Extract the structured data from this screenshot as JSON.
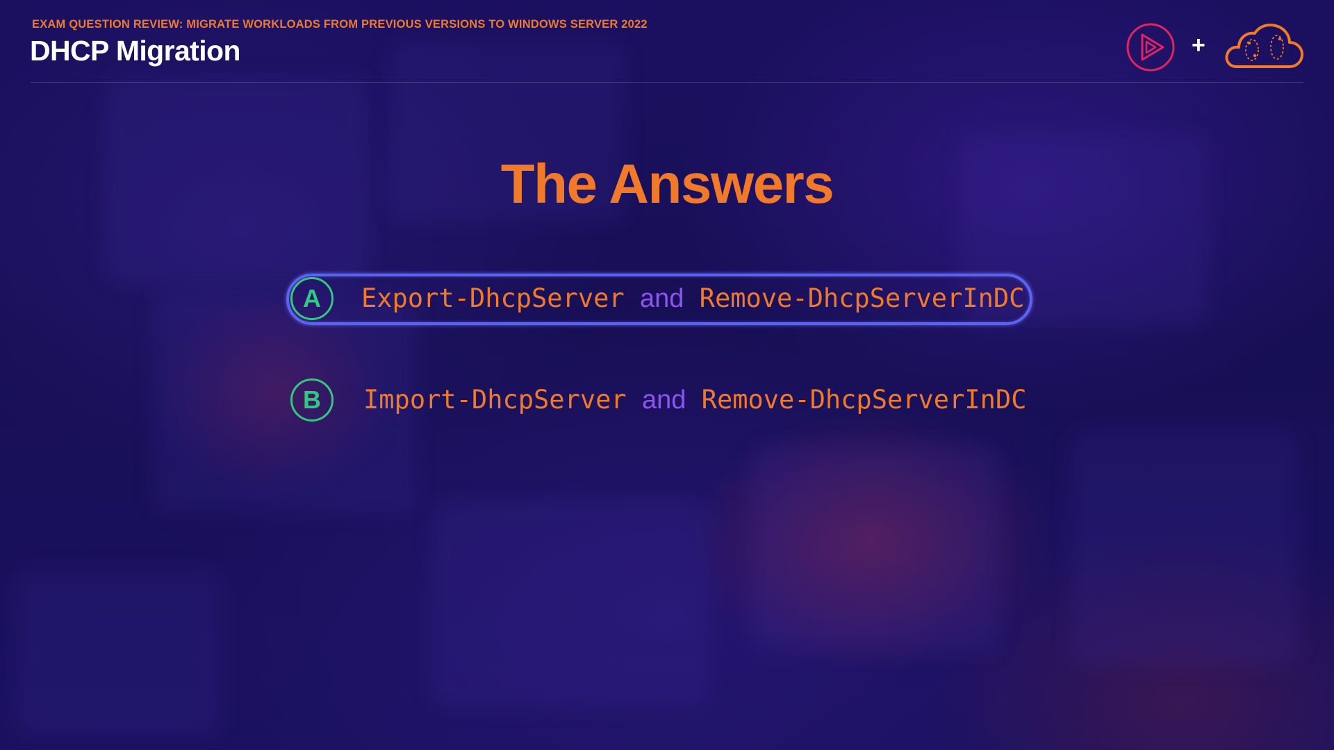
{
  "header": {
    "eyebrow": "EXAM QUESTION REVIEW: MIGRATE WORKLOADS FROM PREVIOUS VERSIONS TO WINDOWS SERVER 2022",
    "title": "DHCP Migration",
    "plus": "+"
  },
  "logos": {
    "left_icon": "play-logo-icon",
    "right_icon": "cloud-logo-icon"
  },
  "heading": "The Answers",
  "answers": [
    {
      "letter": "A",
      "command_1": "Export-DhcpServer",
      "conjunction": "and",
      "command_2": "Remove-DhcpServerInDC",
      "highlighted": true
    },
    {
      "letter": "B",
      "command_1": "Import-DhcpServer",
      "conjunction": "and",
      "command_2": "Remove-DhcpServerInDC",
      "highlighted": false
    }
  ],
  "colors": {
    "accent_orange": "#f07a2a",
    "conjunction_purple": "#8d55f0",
    "badge_green": "#33c87f",
    "highlight_blue": "#5b63f2",
    "play_logo": "#e0255e"
  }
}
